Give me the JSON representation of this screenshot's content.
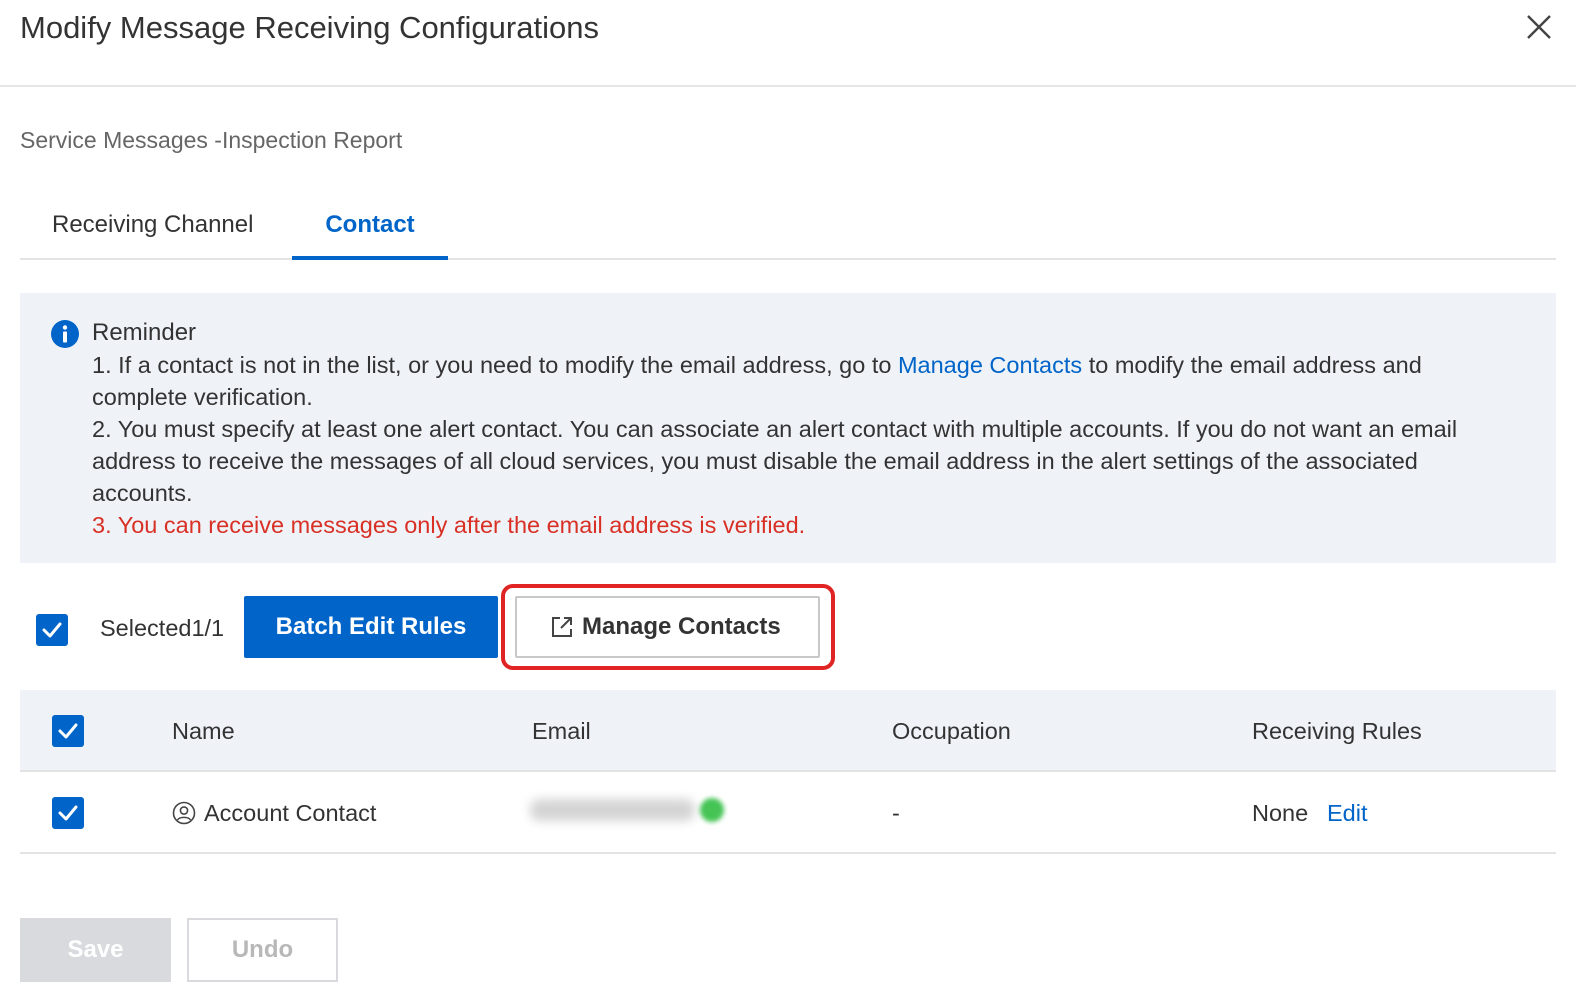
{
  "dialog": {
    "title": "Modify Message Receiving Configurations",
    "subtitle": "Service Messages -Inspection Report"
  },
  "tabs": [
    {
      "label": "Receiving Channel",
      "active": false
    },
    {
      "label": "Contact",
      "active": true
    }
  ],
  "reminder": {
    "title": "Reminder",
    "line1_before": "1. If a contact is not in the list, or you need to modify the email address, go to ",
    "line1_link": "Manage Contacts",
    "line1_after": " to modify the email address and complete verification.",
    "line2": "2. You must specify at least one alert contact. You can associate an alert contact with multiple accounts. If you do not want an email address to receive the messages of all cloud services, you must disable the email address in the alert settings of the associated accounts.",
    "line3": "3. You can receive messages only after the email address is verified."
  },
  "toolbar": {
    "selected_label": "Selected1/1",
    "batch_edit_label": "Batch Edit Rules",
    "manage_contacts_label": "Manage Contacts"
  },
  "table": {
    "columns": [
      "Name",
      "Email",
      "Occupation",
      "Receiving Rules"
    ],
    "rows": [
      {
        "name": "Account Contact",
        "email": "",
        "occupation": "-",
        "rules": "None",
        "action": "Edit",
        "checked": true
      }
    ]
  },
  "footer": {
    "save_label": "Save",
    "undo_label": "Undo"
  },
  "colors": {
    "primary": "#0064c8",
    "warning": "#d93026",
    "highlight": "#e02424",
    "verified": "#45c455"
  }
}
